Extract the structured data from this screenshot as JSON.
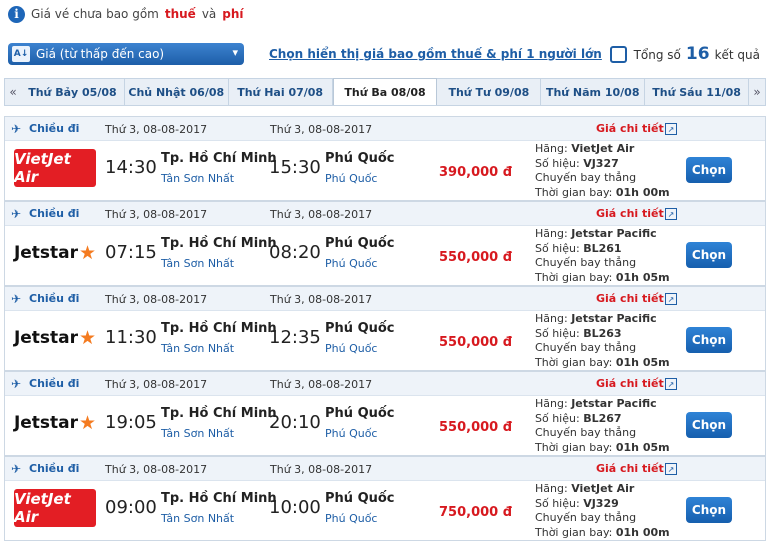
{
  "notice": {
    "prefix": "Giá vé chưa bao gồm",
    "tax": "thuế",
    "and": "và",
    "fee": "phí"
  },
  "sort": {
    "label": "Giá (từ thấp đến cao)",
    "icon_text": "A↓"
  },
  "show_incl_link": "Chọn hiển thị giá bao gồm thuế & phí 1 người lớn",
  "total": {
    "prefix": "Tổng số",
    "count": "16",
    "suffix": "kết quả"
  },
  "dates": [
    {
      "label": "Thứ Bảy 05/08",
      "active": false
    },
    {
      "label": "Chủ Nhật 06/08",
      "active": false
    },
    {
      "label": "Thứ Hai 07/08",
      "active": false
    },
    {
      "label": "Thứ Ba 08/08",
      "active": true
    },
    {
      "label": "Thứ Tư 09/08",
      "active": false
    },
    {
      "label": "Thứ Năm 10/08",
      "active": false
    },
    {
      "label": "Thứ Sáu 11/08",
      "active": false
    }
  ],
  "labels": {
    "direction": "Chiều đi",
    "detail": "Giá chi tiết",
    "airline": "Hãng:",
    "flight_no": "Số hiệu:",
    "direct": "Chuyến bay thẳng",
    "duration": "Thời gian bay:",
    "choose": "Chọn"
  },
  "flights": [
    {
      "logo": "vietjet",
      "logo_text": "VietJet Air",
      "dep_date": "Thứ 3, 08-08-2017",
      "arr_date": "Thứ 3, 08-08-2017",
      "dep_time": "14:30",
      "arr_time": "15:30",
      "from_city": "Tp. Hồ Chí Minh",
      "from_airport": "Tân Sơn Nhất",
      "to_city": "Phú Quốc",
      "to_airport": "Phú Quốc",
      "price": "390,000 đ",
      "airline": "VietJet Air",
      "flight_no": "VJ327",
      "duration": "01h 00m"
    },
    {
      "logo": "jetstar",
      "logo_text": "Jetstar",
      "dep_date": "Thứ 3, 08-08-2017",
      "arr_date": "Thứ 3, 08-08-2017",
      "dep_time": "07:15",
      "arr_time": "08:20",
      "from_city": "Tp. Hồ Chí Minh",
      "from_airport": "Tân Sơn Nhất",
      "to_city": "Phú Quốc",
      "to_airport": "Phú Quốc",
      "price": "550,000 đ",
      "airline": "Jetstar Pacific",
      "flight_no": "BL261",
      "duration": "01h 05m"
    },
    {
      "logo": "jetstar",
      "logo_text": "Jetstar",
      "dep_date": "Thứ 3, 08-08-2017",
      "arr_date": "Thứ 3, 08-08-2017",
      "dep_time": "11:30",
      "arr_time": "12:35",
      "from_city": "Tp. Hồ Chí Minh",
      "from_airport": "Tân Sơn Nhất",
      "to_city": "Phú Quốc",
      "to_airport": "Phú Quốc",
      "price": "550,000 đ",
      "airline": "Jetstar Pacific",
      "flight_no": "BL263",
      "duration": "01h 05m"
    },
    {
      "logo": "jetstar",
      "logo_text": "Jetstar",
      "dep_date": "Thứ 3, 08-08-2017",
      "arr_date": "Thứ 3, 08-08-2017",
      "dep_time": "19:05",
      "arr_time": "20:10",
      "from_city": "Tp. Hồ Chí Minh",
      "from_airport": "Tân Sơn Nhất",
      "to_city": "Phú Quốc",
      "to_airport": "Phú Quốc",
      "price": "550,000 đ",
      "airline": "Jetstar Pacific",
      "flight_no": "BL267",
      "duration": "01h 05m"
    },
    {
      "logo": "vietjet",
      "logo_text": "VietJet Air",
      "dep_date": "Thứ 3, 08-08-2017",
      "arr_date": "Thứ 3, 08-08-2017",
      "dep_time": "09:00",
      "arr_time": "10:00",
      "from_city": "Tp. Hồ Chí Minh",
      "from_airport": "Tân Sơn Nhất",
      "to_city": "Phú Quốc",
      "to_airport": "Phú Quốc",
      "price": "750,000 đ",
      "airline": "VietJet Air",
      "flight_no": "VJ329",
      "duration": "01h 00m"
    }
  ]
}
